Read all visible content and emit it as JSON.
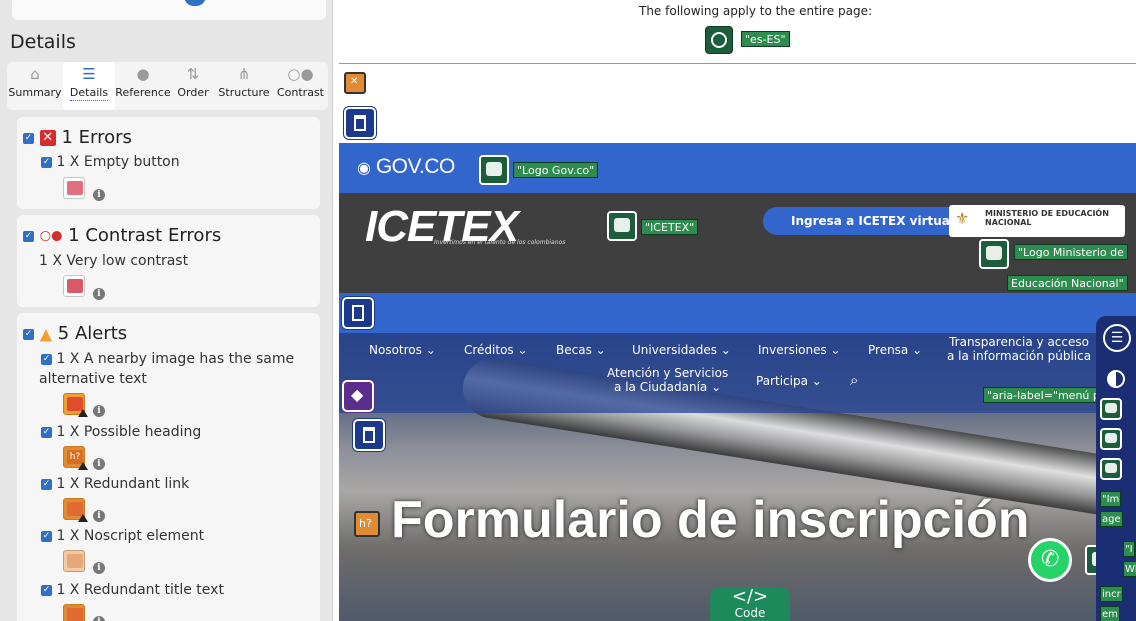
{
  "panel": {
    "title": "Details",
    "tabs": [
      {
        "label": "Summary",
        "icon": "home-icon",
        "glyph": "⌂"
      },
      {
        "label": "Details",
        "icon": "list-icon",
        "glyph": "☰"
      },
      {
        "label": "Reference",
        "icon": "info-icon",
        "glyph": "●"
      },
      {
        "label": "Order",
        "icon": "order-icon",
        "glyph": "⇅"
      },
      {
        "label": "Structure",
        "icon": "structure-icon",
        "glyph": "⋔"
      },
      {
        "label": "Contrast",
        "icon": "contrast-icon",
        "glyph": "○●"
      }
    ],
    "errors": {
      "heading": "1 Errors",
      "items": [
        {
          "label": "1 X Empty button"
        }
      ]
    },
    "contrast": {
      "heading": "1 Contrast Errors",
      "items": [
        {
          "label": "1 X Very low contrast"
        }
      ]
    },
    "alerts": {
      "heading": "5 Alerts",
      "items": [
        {
          "label": "1 X A nearby image has the same",
          "label2": "alternative text"
        },
        {
          "label": "1 X Possible heading"
        },
        {
          "label": "1 X Redundant link"
        },
        {
          "label": "1 X Noscript element"
        },
        {
          "label": "1 X Redundant title text"
        }
      ]
    }
  },
  "page": {
    "apply_text": "The following apply to the entire page:",
    "lang_label": "\"es-ES\"",
    "gov_text": "GOV.CO",
    "gov_logo_label": "\"Logo Gov.co\"",
    "icetex_logo": "ICETEX",
    "icetex_sub": "Invertimos en el talento de los colombianos",
    "icetex_label": "\"ICETEX\"",
    "ingresa": "Ingresa a ICETEX virtual",
    "ministerio": "MINISTERIO DE EDUCACIÓN NACIONAL",
    "ministerio_label_1": "\"Logo Ministerio de",
    "ministerio_label_2": "Educación Nacional\"",
    "nav": [
      "Nosotros ⌄",
      "Créditos ⌄",
      "Becas ⌄",
      "Universidades ⌄",
      "Inversiones ⌄",
      "Prensa ⌄"
    ],
    "nav_transparencia_1": "Transparencia y acceso",
    "nav_transparencia_2": "a la información pública",
    "nav_atencion_1": "Atención y Servicios",
    "nav_atencion_2": "a la Ciudadanía ⌄",
    "nav_participa": "Participa ⌄",
    "aria_label": "\"aria-label=\"menú p",
    "hero_title": "Formulario de inscripción",
    "code_label": "Code",
    "code_glyph": "</>",
    "side_labels": [
      "\"Im",
      "age",
      "\"I",
      "Wh",
      "incr",
      "em"
    ]
  },
  "colors": {
    "accent": "#2f6fc5",
    "error_red": "#d32f2f",
    "alert_orange": "#f0a030",
    "gov_blue": "#3366cc",
    "wave_green": "#1c5e3b"
  }
}
